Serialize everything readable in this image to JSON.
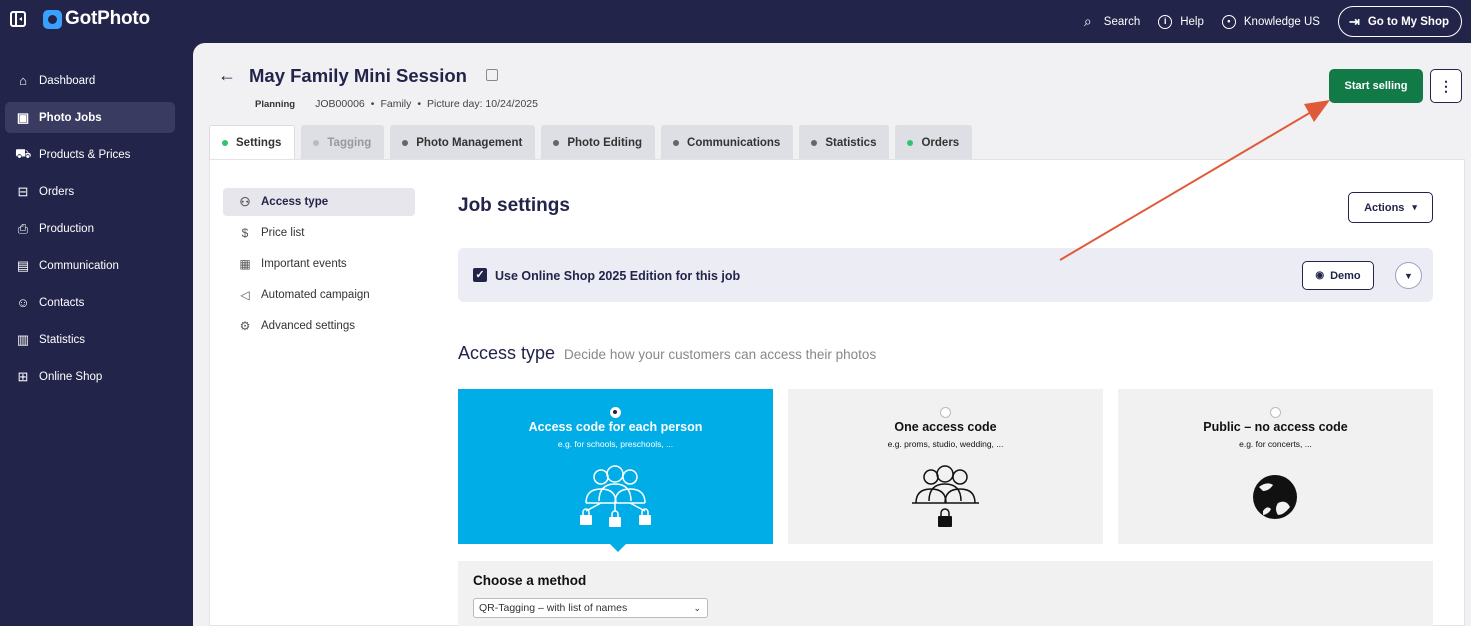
{
  "app": {
    "logo_text": "GotPhoto",
    "top_links": {
      "search": "Search",
      "help": "Help",
      "knowledge": "Knowledge US",
      "go_shop": "Go to My Shop"
    }
  },
  "sidebar": {
    "items": [
      {
        "label": "Dashboard",
        "icon": "home-icon"
      },
      {
        "label": "Photo Jobs",
        "icon": "image-icon",
        "active": true
      },
      {
        "label": "Products & Prices",
        "icon": "cart-icon"
      },
      {
        "label": "Orders",
        "icon": "box-icon"
      },
      {
        "label": "Production",
        "icon": "printer-icon"
      },
      {
        "label": "Communication",
        "icon": "chat-icon"
      },
      {
        "label": "Contacts",
        "icon": "user-icon"
      },
      {
        "label": "Statistics",
        "icon": "chart-icon"
      },
      {
        "label": "Online Shop",
        "icon": "store-icon"
      }
    ]
  },
  "job": {
    "title": "May Family Mini Session",
    "status": "Planning",
    "id": "JOB00006",
    "type": "Family",
    "picture_day": "Picture day: 10/24/2025",
    "start_selling": "Start selling"
  },
  "tabs": [
    {
      "label": "Settings",
      "dot": "green",
      "active": true
    },
    {
      "label": "Tagging",
      "dot": "gray",
      "disabled": true
    },
    {
      "label": "Photo Management",
      "dot": "dark"
    },
    {
      "label": "Photo Editing",
      "dot": "dark"
    },
    {
      "label": "Communications",
      "dot": "dark"
    },
    {
      "label": "Statistics",
      "dot": "dark"
    },
    {
      "label": "Orders",
      "dot": "green"
    }
  ],
  "settings_nav": [
    {
      "label": "Access type",
      "icon": "users-key-icon",
      "active": true
    },
    {
      "label": "Price list",
      "icon": "dollar-icon"
    },
    {
      "label": "Important events",
      "icon": "calendar-icon"
    },
    {
      "label": "Automated campaign",
      "icon": "megaphone-icon"
    },
    {
      "label": "Advanced settings",
      "icon": "gear-icon"
    }
  ],
  "settings": {
    "heading": "Job settings",
    "actions_label": "Actions",
    "shop_edition_label": "Use Online Shop 2025 Edition for this job",
    "demo_label": "Demo",
    "access_heading": "Access type",
    "access_subheading": "Decide how your customers can access their photos",
    "cards": [
      {
        "title": "Access code for each person",
        "subtitle": "e.g. for schools, preschools, ...",
        "selected": true
      },
      {
        "title": "One access code",
        "subtitle": "e.g. proms, studio, wedding, ...",
        "selected": false
      },
      {
        "title": "Public – no access code",
        "subtitle": "e.g. for concerts, ...",
        "selected": false
      }
    ],
    "method_title": "Choose a method",
    "method_value": "QR-Tagging – with list of names"
  },
  "colors": {
    "navy": "#23244a",
    "green": "#117a47",
    "cyan": "#00ade6",
    "annotation_arrow": "#e05a3a"
  }
}
